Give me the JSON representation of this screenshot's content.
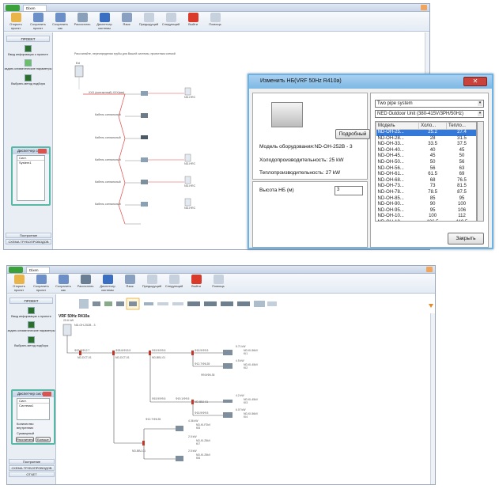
{
  "top": {
    "tab_title": "Dixen",
    "ribbon": [
      {
        "label": "Открыть проект",
        "color": "#e9b54a"
      },
      {
        "label": "Сохранить проект",
        "color": "#6c8fc7"
      },
      {
        "label": "Сохранить как",
        "color": "#6c8fc7"
      },
      {
        "label": "Рассчитать",
        "color": "#8aa0b8"
      },
      {
        "label": "Диспетчер системы",
        "color": "#3b6fc2"
      },
      {
        "label": "Язык",
        "color": "#8aa0c0"
      },
      {
        "label": "Предыдущий",
        "color": "#c7d1de"
      },
      {
        "label": "Следующий",
        "color": "#c7d1de"
      },
      {
        "label": "Выйти",
        "color": "#d93a2a"
      },
      {
        "label": "Помощь",
        "color": "#c7d1de"
      }
    ],
    "sidebar": {
      "header": "ПРОЕКТ",
      "items": [
        "Ввод информации о проекте",
        "задать климатические параметры",
        "Выбрать метод подбора"
      ],
      "sysmgr_title": "Диспетчер сист.",
      "sysmgr_col": "Сист.",
      "sysmgr_row": "System1",
      "footer1": "Построение",
      "footer2": "СХЕМА ТРУБОПРОВОДОВ"
    },
    "canvas_caption": "Рассчитайте, переопределяя трубы для Вашей системы, проектным схемой",
    "outdoor_label": "Ext",
    "branch_label": "Кабель сигнальный",
    "main_branch_label": "XXX (контактный) XXX(мм)",
    "indoor_labels": [
      "ND-HRC",
      "ND-HRC",
      "ND-HRC",
      "ND-HRC"
    ],
    "dialog": {
      "title": "Изменить НБ(VRF 50Hz R410a)",
      "detail_button": "Подробный",
      "model_label": "Модель оборудования:ND-OH-252B - 3",
      "cooling_label": "Холодопроизводительность: 25 kW",
      "heating_label": "Теплопроизводительность: 27 kW",
      "height_label": "Высота НБ (м)",
      "height_value": "3",
      "system_select": "Two pipe system",
      "unit_select": "NED Outdoor Unit (380-415V/3PH/50Hz)",
      "columns": [
        "Модель",
        "Холо...",
        "Тепло..."
      ],
      "rows": [
        [
          "ND-OH-25...",
          "25.2",
          "27.4"
        ],
        [
          "ND-OH-28...",
          "28",
          "31.5"
        ],
        [
          "ND-OH-33...",
          "33.5",
          "37.5"
        ],
        [
          "ND-OH-40...",
          "40",
          "45"
        ],
        [
          "ND-OH-45...",
          "45",
          "50"
        ],
        [
          "ND-OH-50...",
          "50",
          "56"
        ],
        [
          "ND-OH-56...",
          "56",
          "63"
        ],
        [
          "ND-OH-61...",
          "61.5",
          "69"
        ],
        [
          "ND-OH-68...",
          "68",
          "76.5"
        ],
        [
          "ND-OH-73...",
          "73",
          "81.5"
        ],
        [
          "ND-OH-78...",
          "78.5",
          "87.5"
        ],
        [
          "ND-OH-85...",
          "85",
          "95"
        ],
        [
          "ND-OH-90...",
          "90",
          "100"
        ],
        [
          "ND-OH-95...",
          "95",
          "106"
        ],
        [
          "ND-OH-10...",
          "100",
          "112"
        ],
        [
          "ND-OH-10...",
          "106.5",
          "119.5"
        ]
      ],
      "calc_button": "Закрыть"
    }
  },
  "bottom": {
    "tab_title": "Dixen",
    "ribbon": [
      {
        "label": "Открыть проект",
        "color": "#e9b54a"
      },
      {
        "label": "Сохранить проект",
        "color": "#6c8fc7"
      },
      {
        "label": "Сохранить как",
        "color": "#6c8fc7"
      },
      {
        "label": "Рассчитать",
        "color": "#6b7f94"
      },
      {
        "label": "Диспетчер системы",
        "color": "#3b6fc2"
      },
      {
        "label": "Язык",
        "color": "#8aa0c0"
      },
      {
        "label": "Предыдущий",
        "color": "#c7d1de"
      },
      {
        "label": "Следующий",
        "color": "#c7d1de"
      },
      {
        "label": "Выйти",
        "color": "#d93a2a"
      },
      {
        "label": "Помощь",
        "color": "#c7d1de"
      }
    ],
    "sidebar": {
      "header": "ПРОЕКТ",
      "items": [
        "Ввод информации о проекте",
        "задать климатические параметры",
        "Выбрать метод подбора"
      ],
      "sysmgr_title": "Диспетчер сист.",
      "sysmgr_col": "Сист.",
      "sysmgr_row": "Система1",
      "count_label": "Количество внутренних",
      "sum_label": "Суммарный",
      "calc_button": "Рассчитать",
      "more_button": "Больше",
      "footer1": "Построение",
      "footer2": "СХЕМА ТРУБОПРОВОДОВ",
      "footer3": "ОТЧЕТ"
    },
    "canvas_title": "VRF 50Hz R410a",
    "outdoor_info": "25.6 kW",
    "outdoor_model": "ND-OH-252B - 3",
    "pipe_labels": [
      "Ф22.2/Ф12.7",
      "Ф28.6/Ф15.9",
      "Ф15.9/Ф9.5",
      "Ф15.9/Ф9.5",
      "Ф12.7/Ф6.35",
      "Ф9.5/Ф6.35",
      "Ф15.9/Ф9.5",
      "Ф19.1/Ф9.5",
      "Ф15.9/Ф9.5",
      "Ф12.7/Ф6.35"
    ],
    "joint_labels": [
      "ND-DCT-01",
      "ND-DCT-01",
      "ND-BBJ-01",
      "ND-BBJ-01",
      "ND-BBJ-01"
    ],
    "indoor": [
      {
        "cap": "5.71 kW",
        "model": "ND-KI-56kV",
        "tag": "KI1"
      },
      {
        "cap": "4.5 kW",
        "model": "ND-KI-45kV",
        "tag": "KI2"
      },
      {
        "cap": "4.2 kW",
        "model": "ND-KI-45kV",
        "tag": "KI3"
      },
      {
        "cap": "6.07 kW",
        "model": "ND-KI-56kV",
        "tag": "KI4"
      },
      {
        "cap": "4.36 kW",
        "model": "ND-KI-F2kV",
        "tag": "KI5"
      },
      {
        "cap": "2.5 kW",
        "model": "ND-KI-25kV",
        "tag": "KI6"
      },
      {
        "cap": "2.5 kW",
        "model": "ND-KI-25kV",
        "tag": "KI7"
      }
    ]
  }
}
